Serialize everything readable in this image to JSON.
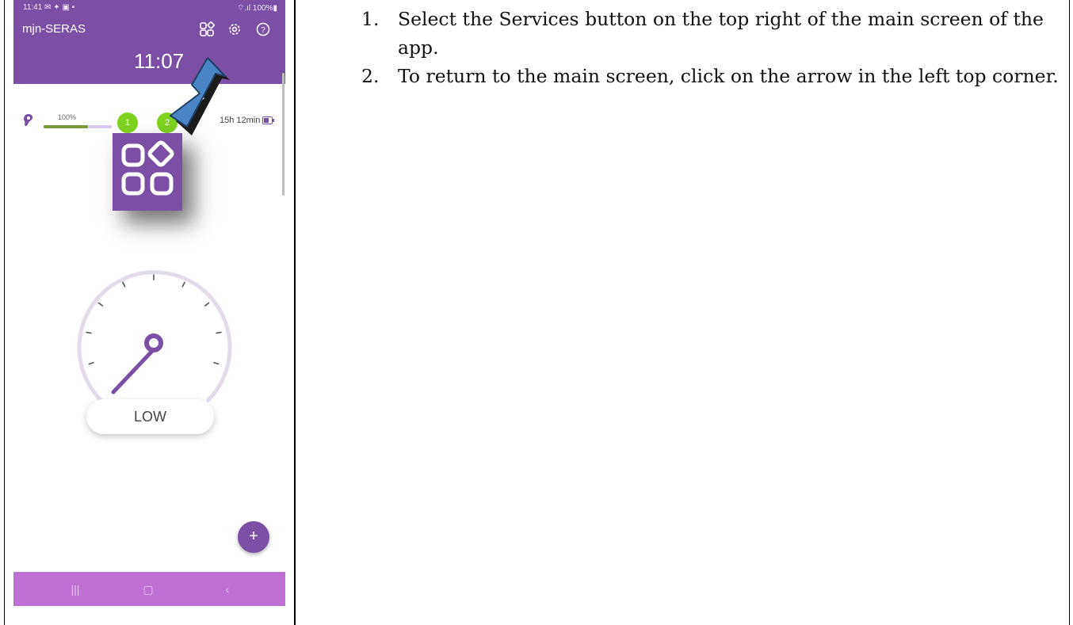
{
  "phone": {
    "status_bar": {
      "time": "11:41 ✉ ✦ ▣ •",
      "right": "⌔.ıl 100%▮"
    },
    "app_name": "mjn-SERAS",
    "clock": "11:07",
    "header_icons": [
      "services-icon",
      "gear-icon",
      "help-icon"
    ],
    "device": {
      "level_percent_label": "100%",
      "level_fraction": 0.65,
      "programs": [
        "1",
        "2"
      ],
      "runtime": "15h 12min"
    },
    "gauge": {
      "ticks": 11,
      "needle_level": "low"
    },
    "level_button": "LOW",
    "fab_label": "+",
    "nav": {
      "recents": "|||",
      "home": "▢",
      "back": "‹"
    }
  },
  "colors": {
    "accent": "#7b4fa6",
    "program_badge": "#7ed321",
    "nav_bar": "#c070d4",
    "arrow_fill": "#4a86c5"
  },
  "instructions": [
    {
      "number": "1.",
      "text": "Select the Services button on the top right of the main screen of the app."
    },
    {
      "number": "2.",
      "text": "To return to the main screen, click on the arrow in the left top corner."
    }
  ]
}
